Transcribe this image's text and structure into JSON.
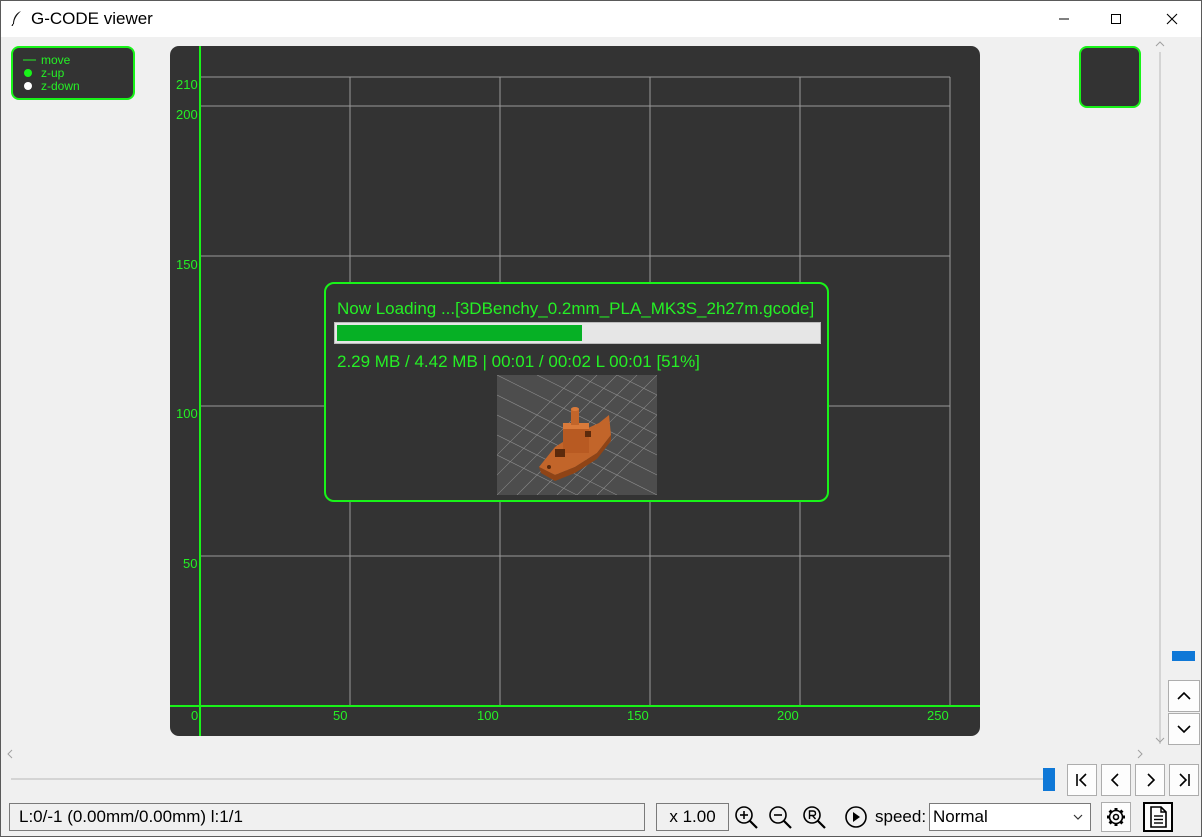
{
  "window": {
    "title": "G-CODE viewer"
  },
  "legend": [
    {
      "label": "move",
      "symbol": "line"
    },
    {
      "label": "z-up",
      "symbol": "dot-green"
    },
    {
      "label": "z-down",
      "symbol": "dot-white"
    }
  ],
  "plot": {
    "x_ticks": [
      "0",
      "50",
      "100",
      "150",
      "200",
      "250"
    ],
    "y_ticks": [
      "50",
      "100",
      "150",
      "200",
      "210"
    ],
    "x_range": [
      0,
      250
    ],
    "y_range": [
      0,
      210
    ],
    "grid": true
  },
  "loading": {
    "title": "Now Loading ...[3DBenchy_0.2mm_PLA_MK3S_2h27m.gcode]",
    "progress_percent": 51,
    "stats": "2.29 MB / 4.42 MB | 00:01 / 00:02 L 00:01 [51%]",
    "thumbnail": "3d-benchy-preview"
  },
  "status": {
    "position_text": "L:0/-1 (0.00mm/0.00mm) l:1/1",
    "zoom": "x 1.00",
    "speed_label": "speed:",
    "speed_value": "Normal"
  },
  "scrollbars": {
    "vertical_position": 0.88,
    "horizontal_position": 1.0
  },
  "colors": {
    "accent": "#19f319",
    "canvas": "#333333",
    "progress": "#06b025",
    "slider": "#0f78d7"
  }
}
